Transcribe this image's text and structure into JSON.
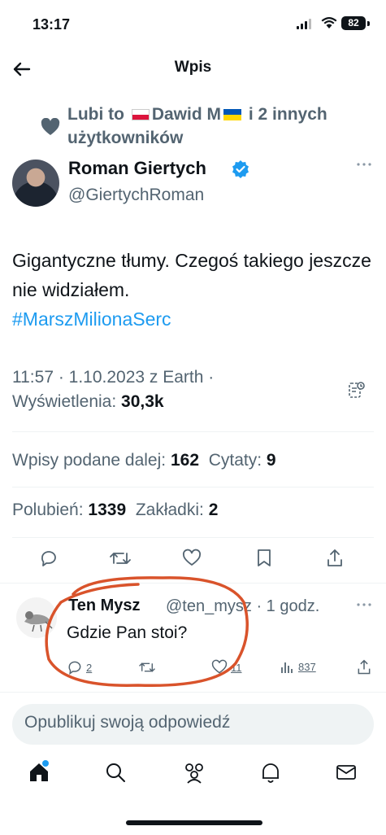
{
  "status": {
    "time": "13:17",
    "battery": "82"
  },
  "header": {
    "title": "Wpis"
  },
  "liked_by": {
    "prefix": "Lubi to",
    "user": "Dawid M",
    "suffix": "i 2 innych użytkowników"
  },
  "author": {
    "name": "Roman Giertych",
    "handle": "@GiertychRoman"
  },
  "tweet": {
    "text": "Gigantyczne tłumy. Czegoś takiego jeszcze nie widziałem.",
    "hashtag": "#MarszMilionaSerc",
    "meta": "11:57 · 1.10.2023 z Earth ·",
    "views_label": "Wyświetlenia:",
    "views_value": "30,3k"
  },
  "stats": {
    "retweets_label": "Wpisy podane dalej:",
    "retweets_value": "162",
    "quotes_label": "Cytaty:",
    "quotes_value": "9",
    "likes_label": "Polubień:",
    "likes_value": "1339",
    "bookmarks_label": "Zakładki:",
    "bookmarks_value": "2"
  },
  "reply": {
    "name": "Ten Mysz",
    "handle": "@ten_mysz · 1 godz.",
    "text": "Gdzie Pan stoi?",
    "replies": "2",
    "likes": "11",
    "views": "837"
  },
  "compose": {
    "placeholder": "Opublikuj swoją odpowiedź"
  },
  "colors": {
    "accent": "#1d9bf0",
    "annotation": "#d9532b",
    "muted": "#536471"
  },
  "icons": [
    "back-arrow-icon",
    "heart-icon",
    "verified-icon",
    "more-icon",
    "analytics-icon",
    "reply-icon",
    "retweet-icon",
    "like-icon",
    "bookmark-icon",
    "share-icon",
    "views-icon",
    "home-icon",
    "search-icon",
    "communities-icon",
    "notifications-icon",
    "messages-icon"
  ]
}
